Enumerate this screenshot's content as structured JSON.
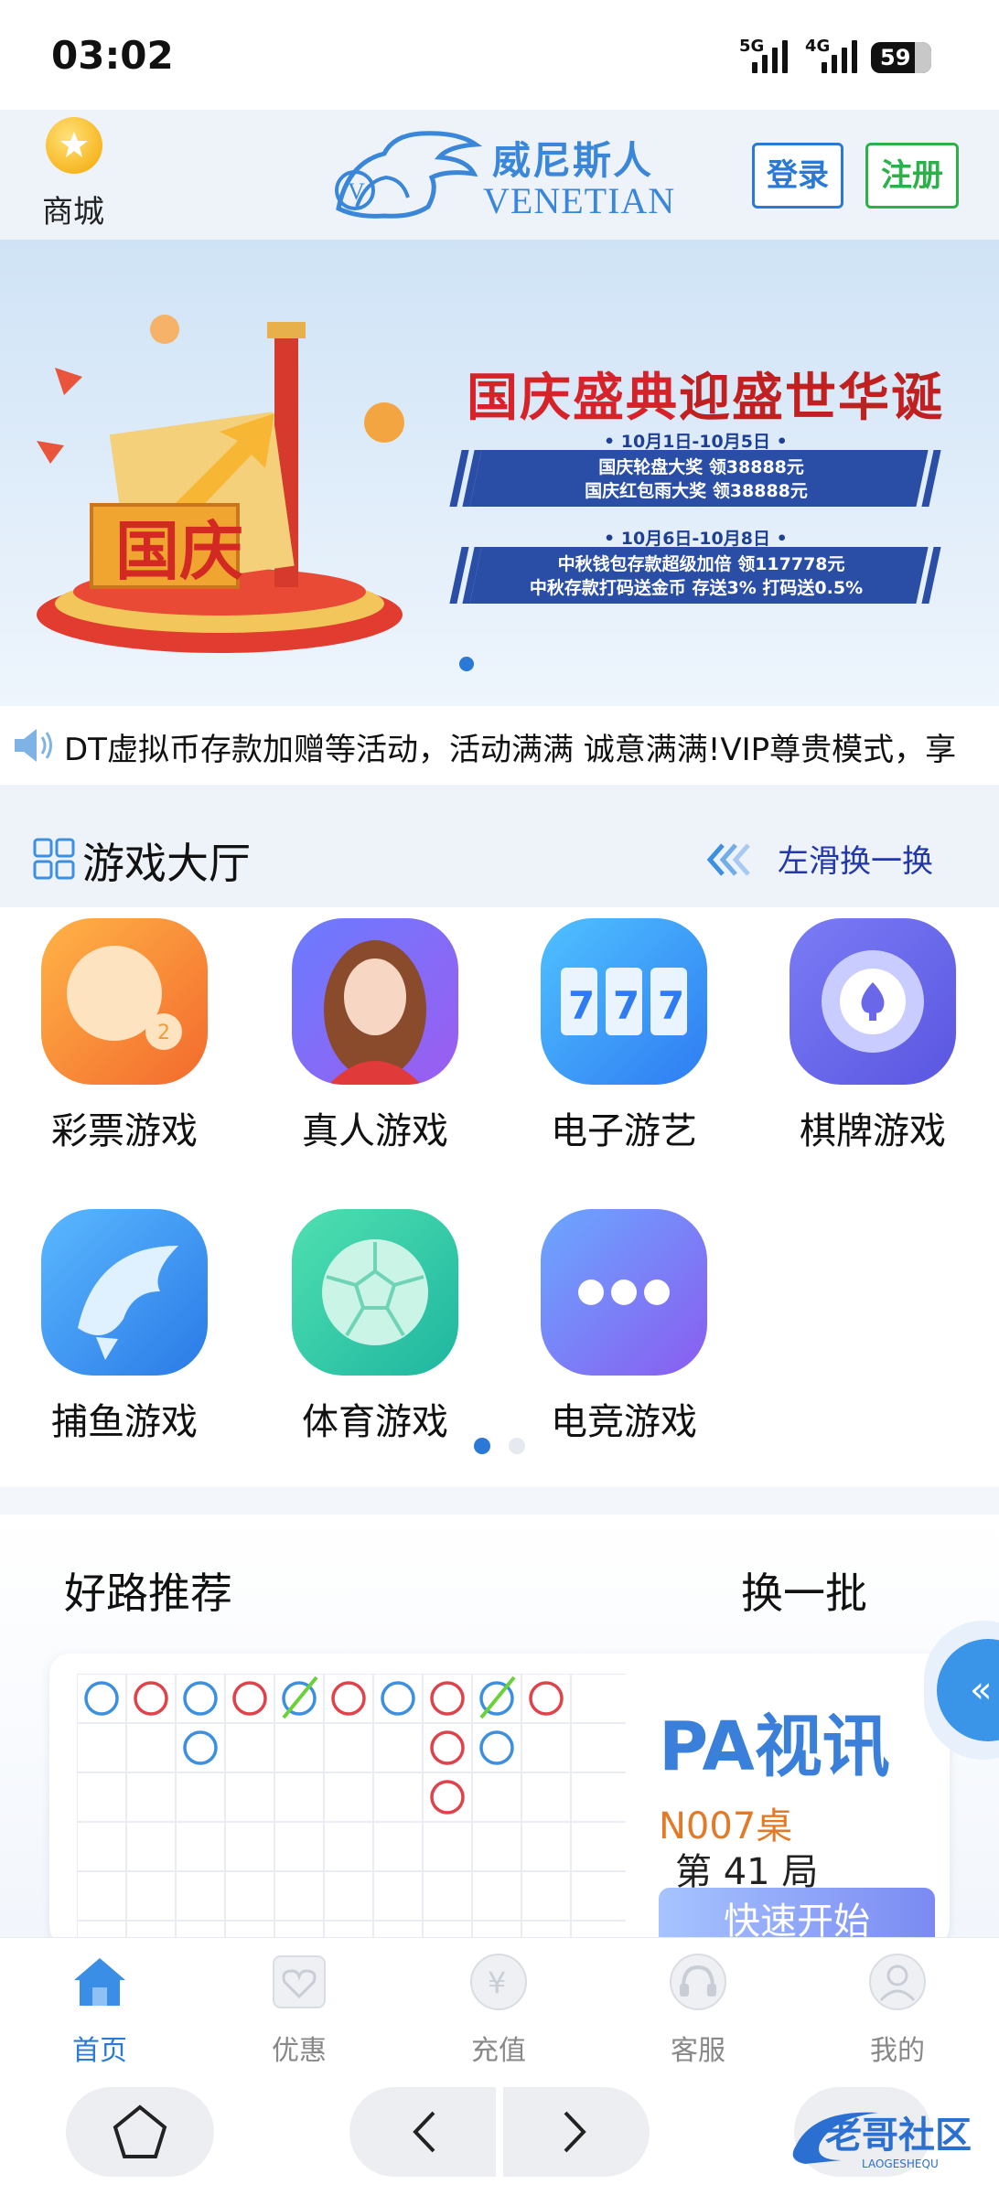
{
  "status_bar": {
    "time": "03:02",
    "signal1_label": "5G",
    "signal2_label": "4G",
    "battery": "59"
  },
  "header": {
    "mall_label": "商城",
    "logo_cn": "威尼斯人",
    "logo_en": "VENETIAN",
    "login_label": "登录",
    "register_label": "注册"
  },
  "banner": {
    "title_part1": "国庆盛典",
    "title_part2": "迎盛世华诞",
    "date1": "• 10月1日-10月5日 •",
    "line1": "国庆轮盘大奖  领38888元",
    "line2": "国庆红包雨大奖  领38888元",
    "date2": "• 10月6日-10月8日 •",
    "line3": "中秋钱包存款超级加倍  领117778元",
    "line4": "中秋存款打码送金币  存送3%  打码送0.5%",
    "art_text": "国庆"
  },
  "marquee": {
    "text": "DT虚拟币存款加赠等活动，活动满满 诚意满满!VIP尊贵模式，享"
  },
  "game_hall": {
    "title": "游戏大厅",
    "swipe_label": "左滑换一换",
    "games": [
      {
        "label": "彩票游戏",
        "icon": "lottery-icon"
      },
      {
        "label": "真人游戏",
        "icon": "live-dealer-icon"
      },
      {
        "label": "电子游艺",
        "icon": "slot-777-icon"
      },
      {
        "label": "棋牌游戏",
        "icon": "poker-chip-icon"
      },
      {
        "label": "捕鱼游戏",
        "icon": "shark-icon"
      },
      {
        "label": "体育游戏",
        "icon": "soccer-ball-icon"
      },
      {
        "label": "电竞游戏",
        "icon": "more-dots-icon"
      }
    ]
  },
  "recommend": {
    "title": "好路推荐",
    "refresh_label": "换一批",
    "provider": "PA视讯",
    "table_no": "N007桌",
    "round": "第 41 局",
    "quick_start": "快速开始"
  },
  "float_button": {
    "symbol": "«"
  },
  "tabbar": {
    "items": [
      {
        "label": "首页",
        "icon": "home-icon",
        "active": true
      },
      {
        "label": "优惠",
        "icon": "gift-icon",
        "active": false
      },
      {
        "label": "充值",
        "icon": "yuan-coin-icon",
        "active": false
      },
      {
        "label": "客服",
        "icon": "headset-icon",
        "active": false
      },
      {
        "label": "我的",
        "icon": "user-icon",
        "active": false
      }
    ]
  },
  "watermark": {
    "text": "老哥社区",
    "sub": "LAOGESHEQU"
  },
  "colors": {
    "accent_blue": "#2a79d6",
    "register_green": "#2bb04a",
    "banner_red": "#d8222a",
    "banner_panel": "#2a4ea6",
    "road_red": "#e0424a",
    "road_blue": "#3d8fe0"
  }
}
